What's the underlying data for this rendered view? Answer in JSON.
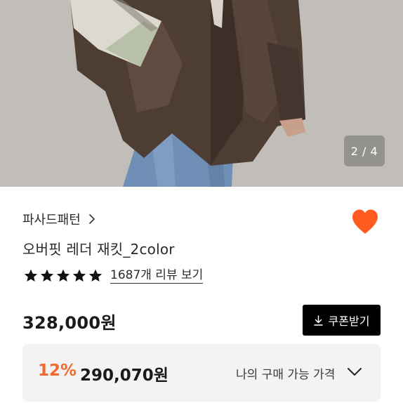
{
  "gallery": {
    "counter": "2 / 4",
    "colors": {
      "background": "#bdbab5",
      "jacket": "#4e3d33",
      "denim": "#6f8fb6",
      "bag": "#dcdad0"
    }
  },
  "product": {
    "brand": "파사드패턴",
    "title": "오버핏 레더 재킷_2color",
    "rating": {
      "stars": 5,
      "review_link": "1687개 리뷰 보기"
    },
    "price": "328,000원",
    "coupon_button": "쿠폰받기",
    "discount": {
      "rate": "12%",
      "price": "290,070원",
      "my_price_label": "나의 구매 가능 가격"
    }
  },
  "icons": {
    "heart": "heart-icon",
    "brand_chevron": "chevron-right-icon",
    "star": "star-icon",
    "download": "download-icon",
    "expand": "chevron-down-icon"
  },
  "accent_colors": {
    "heart": "#ff5a1f",
    "discount_rate": "#f06a2c",
    "button": "#000000"
  }
}
